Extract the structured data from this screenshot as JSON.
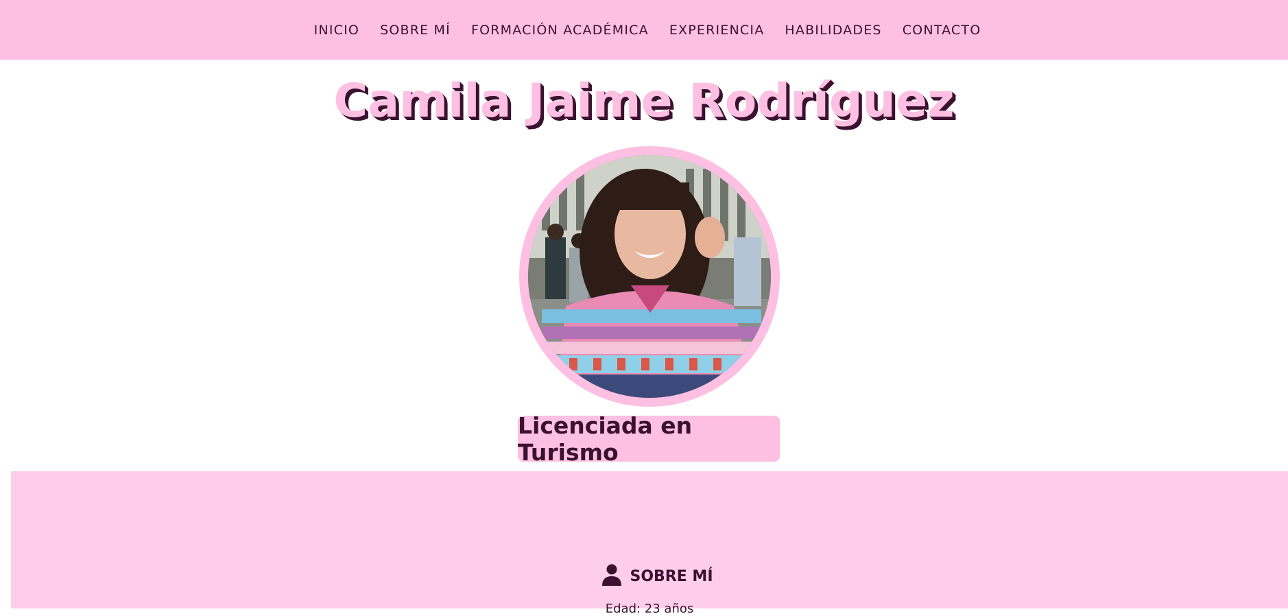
{
  "nav": {
    "items": [
      {
        "label": "INICIO"
      },
      {
        "label": "SOBRE MÍ"
      },
      {
        "label": "FORMACIÓN ACADÉMICA"
      },
      {
        "label": "EXPERIENCIA"
      },
      {
        "label": "HABILIDADES"
      },
      {
        "label": "CONTACTO"
      }
    ]
  },
  "hero": {
    "name": "Camila Jaime Rodríguez",
    "subtitle": "Licenciada en Turismo"
  },
  "about": {
    "heading": "SOBRE MÍ",
    "first_line": "Edad: 23 años"
  },
  "colors": {
    "nav_bg": "#fdbfe2",
    "section_bg": "#fdcdea",
    "text": "#3a1230"
  },
  "icons": {
    "about": "person-icon"
  }
}
